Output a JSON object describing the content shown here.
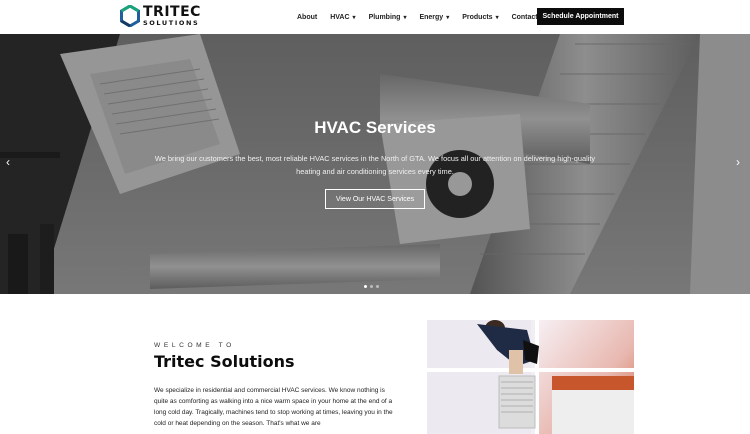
{
  "brand": {
    "name_top": "TRITEC",
    "name_bottom": "SOLUTIONS",
    "colors": {
      "green": "#1aa37a",
      "blue": "#1f5f9e",
      "navy": "#163a63"
    }
  },
  "nav": {
    "items": [
      {
        "label": "About",
        "has_dropdown": false
      },
      {
        "label": "HVAC",
        "has_dropdown": true
      },
      {
        "label": "Plumbing",
        "has_dropdown": true
      },
      {
        "label": "Energy",
        "has_dropdown": true
      },
      {
        "label": "Products",
        "has_dropdown": true
      },
      {
        "label": "Contact",
        "has_dropdown": false
      }
    ],
    "dropdown_icon": "chevron-down-icon",
    "cta_label": "Schedule Appointment"
  },
  "hero": {
    "title": "HVAC Services",
    "subtitle": "We bring our customers the best, most reliable HVAC services in the North of GTA. We focus all our attention on delivering high-quality heating and air conditioning services every time.",
    "button_label": "View Our HVAC Services",
    "prev_icon": "chevron-left-icon",
    "next_icon": "chevron-right-icon",
    "prev_glyph": "‹",
    "next_glyph": "›",
    "slide_count": 3,
    "active_slide": 1
  },
  "welcome": {
    "eyebrow": "WELCOME TO",
    "title": "Tritec Solutions",
    "body": "We specialize in residential and commercial HVAC services. We know nothing is quite as comforting as walking into a nice warm space in your home at the end of a long cold day. Tragically, machines tend to stop working at times, leaving you in the cold or heat depending on the season. That's what we are"
  }
}
